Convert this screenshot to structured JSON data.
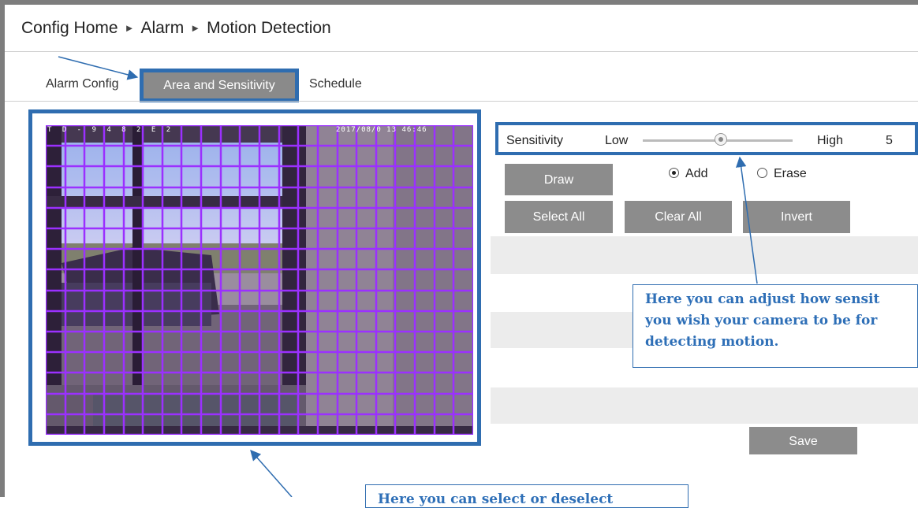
{
  "breadcrumb": {
    "items": [
      "Config Home",
      "Alarm",
      "Motion Detection"
    ],
    "separator": "►"
  },
  "tabs": [
    {
      "label": "Alarm Config",
      "active": false
    },
    {
      "label": "Area and Sensitivity",
      "active": true
    },
    {
      "label": "Schedule",
      "active": false
    }
  ],
  "video": {
    "osd_left": "T D - 9 4 8 2 E 2",
    "osd_right": "2017/08/0 13 46:46",
    "grid_color": "#9b30ff"
  },
  "sensitivity": {
    "label": "Sensitivity",
    "low_label": "Low",
    "high_label": "High",
    "value": "5",
    "slider_fraction": 0.52
  },
  "controls": {
    "draw_label": "Draw",
    "add_label": "Add",
    "erase_label": "Erase",
    "mode_selected": "Add",
    "select_all_label": "Select All",
    "clear_all_label": "Clear All",
    "invert_label": "Invert",
    "save_label": "Save"
  },
  "callouts": {
    "right": [
      "Here you can adjust how sensit",
      "you wish your camera to be for",
      "detecting motion."
    ],
    "bottom": "Here you can select or deselect"
  },
  "colors": {
    "accent": "#2f6db0",
    "button": "#8c8c8c",
    "callout_text": "#2e6fb7"
  }
}
